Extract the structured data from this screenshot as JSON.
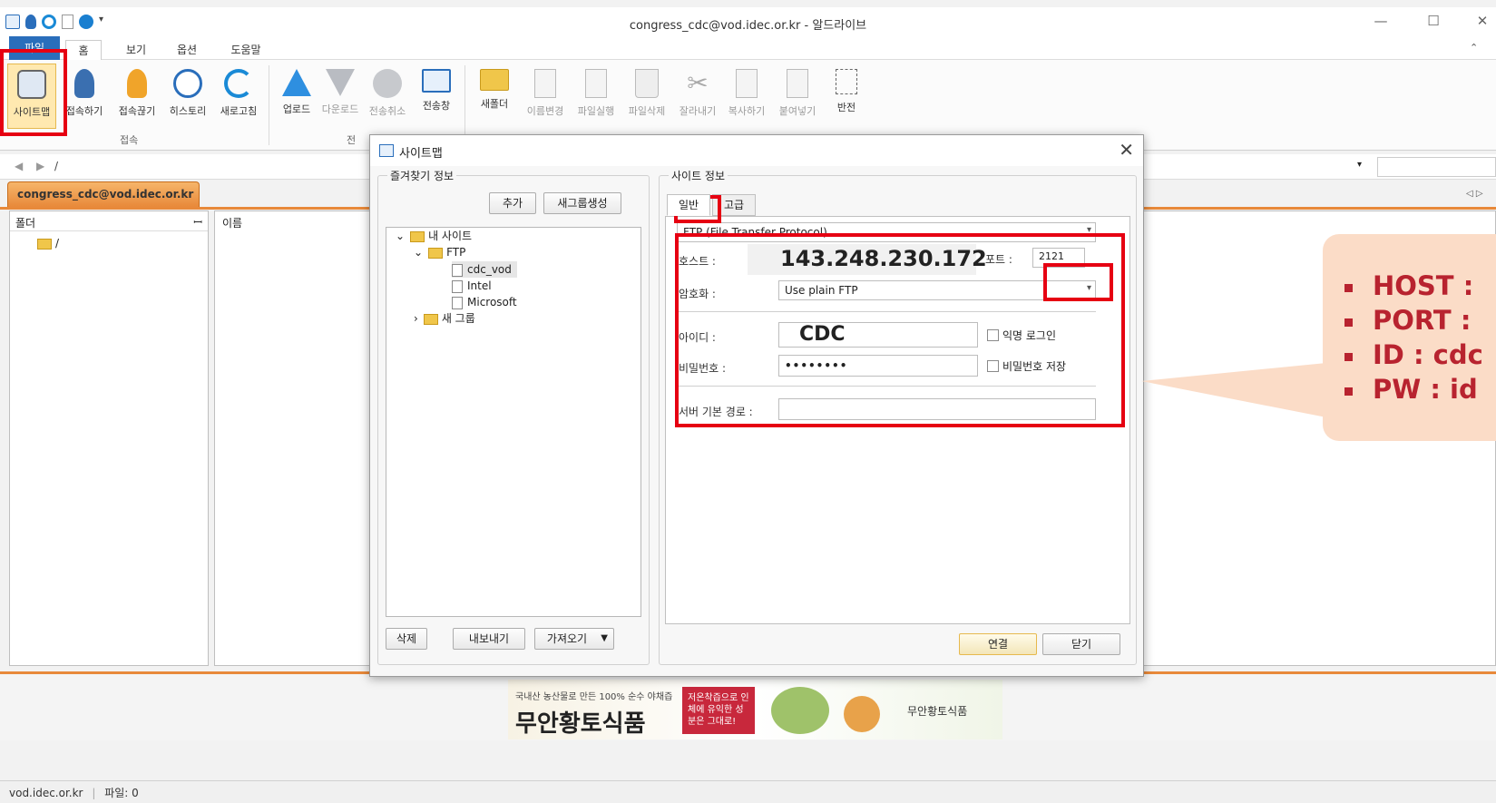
{
  "window": {
    "title": "congress_cdc@vod.idec.or.kr - 알드라이브"
  },
  "menu": {
    "file": "파일",
    "home": "홈",
    "view": "보기",
    "options": "옵션",
    "help": "도움말"
  },
  "ribbon": {
    "connect_group": "접속",
    "transfer_group_partial": "전",
    "buttons": {
      "sitemap": "사이트맵",
      "connect": "접속하기",
      "disconnect": "접속끊기",
      "history": "히스토리",
      "refresh": "새로고침",
      "upload": "업로드",
      "download": "다운로드",
      "cancel_transfer": "전송취소",
      "transfer_window": "전송창",
      "new_folder": "새폴더",
      "rename": "이름변경",
      "run_file": "파일실행",
      "delete_file": "파일삭제",
      "cut": "잘라내기",
      "copy": "복사하기",
      "paste": "붙여넣기",
      "invert": "반전"
    }
  },
  "address": {
    "path": "/"
  },
  "session_tab": "congress_cdc@vod.idec.or.kr",
  "panes": {
    "folder_header": "폴더",
    "root_folder": "/",
    "name_header": "이름"
  },
  "status": {
    "host": "vod.idec.or.kr",
    "files": "파일: 0"
  },
  "dialog": {
    "title": "사이트맵",
    "favorites": {
      "legend": "즐겨찾기 정보",
      "add_button": "추가",
      "new_group_button": "새그룹생성",
      "tree": {
        "my_sites": "내 사이트",
        "ftp": "FTP",
        "items": [
          "cdc_vod",
          "Intel",
          "Microsoft"
        ],
        "new_group": "새 그룹"
      },
      "delete_button": "삭제",
      "export_button": "내보내기",
      "import_button": "가져오기"
    },
    "site": {
      "legend": "사이트 정보",
      "tab_general": "일반",
      "tab_advanced": "고급",
      "protocol": "FTP (File Transfer Protocol)",
      "host_label": "호스트 :",
      "host_value": "143.248.230.172",
      "port_label": "포트 :",
      "port_value": "2121",
      "encryption_label": "암호화 :",
      "encryption_value": "Use plain FTP",
      "id_label": "아이디 :",
      "id_value": "CDC",
      "anon_login": "익명 로그인",
      "password_label": "비밀번호 :",
      "password_value": "••••••••",
      "save_password": "비밀번호 저장",
      "base_path_label": "서버 기본 경로 :"
    },
    "connect_button": "연결",
    "close_button": "닫기"
  },
  "callout": {
    "items": [
      "HOST :",
      "PORT :",
      "ID : cdc",
      "PW : id"
    ]
  },
  "ad": {
    "text_small": "국내산 농산물로 만든 100% 순수 야채즙",
    "text_big": "무안황토식품",
    "badge": "저온착즙으로 인체에 유익한 성분은 그대로!",
    "brand": "무안황토식품"
  },
  "colors": {
    "accent_orange": "#e8893a",
    "highlight_red": "#e60012",
    "callout_bg": "#fbdcc7",
    "callout_text": "#b8232f"
  }
}
